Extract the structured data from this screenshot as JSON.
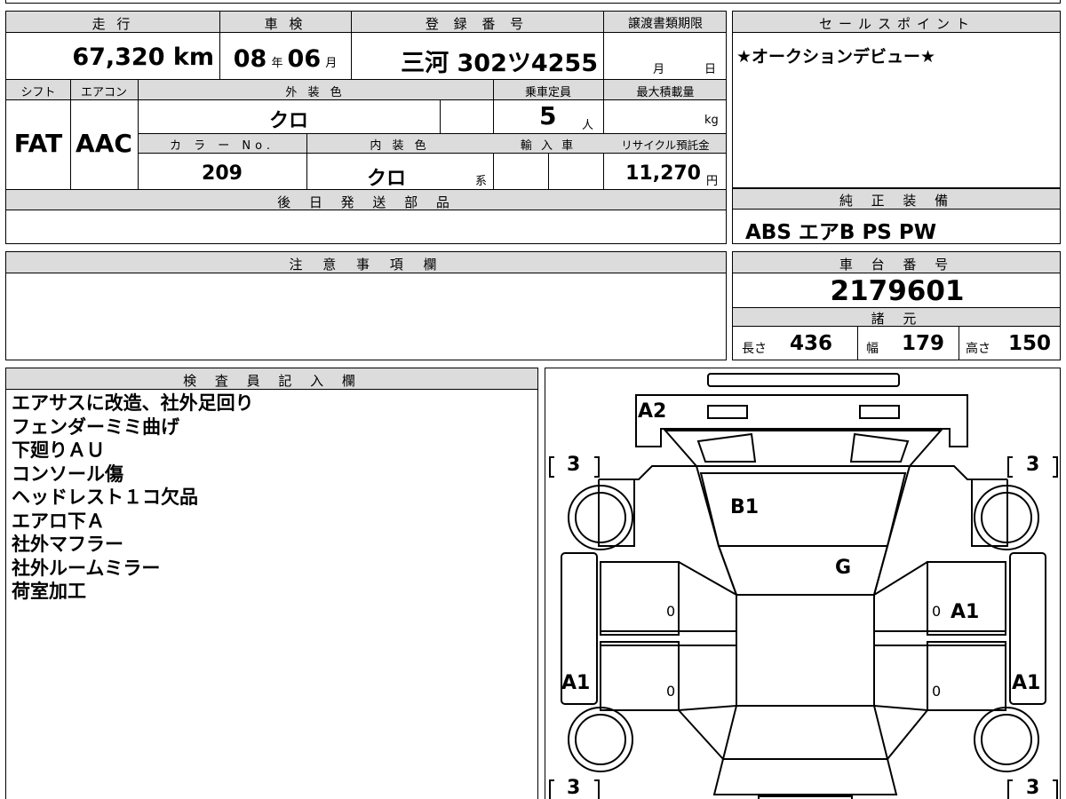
{
  "header": {
    "mileage_label": "走 行",
    "inspection_label": "車 検",
    "registration_label": "登 録 番 号",
    "transfer_deadline_label": "譲渡書類期限",
    "mileage_value": "67,320 km",
    "inspection_year": "08",
    "inspection_year_unit": "年",
    "inspection_month": "06",
    "inspection_month_unit": "月",
    "registration_value": "三河 302ツ4255",
    "deadline_month_unit": "月",
    "deadline_day_unit": "日"
  },
  "specs": {
    "shift_label": "シフト",
    "ac_label": "エアコン",
    "exterior_label": "外 装 色",
    "capacity_label": "乗車定員",
    "max_load_label": "最大積載量",
    "shift_value": "FAT",
    "ac_value": "AAC",
    "exterior_value": "クロ",
    "capacity_value": "5",
    "capacity_unit": "人",
    "max_load_unit": "kg",
    "color_no_label": "カ ラ ー No.",
    "interior_label": "内 装 色",
    "import_label": "輸 入 車",
    "recycle_label": "リサイクル預託金",
    "color_no_value": "209",
    "interior_value": "クロ",
    "interior_suffix": "系",
    "recycle_value": "11,270",
    "recycle_unit": "円"
  },
  "deferred_parts": {
    "label": "後 日 発 送 部 品",
    "value": ""
  },
  "notes": {
    "label": "注 意 事 項 欄",
    "value": ""
  },
  "sales_point": {
    "label": "セールスポイント",
    "value": "★オークションデビュー★"
  },
  "equipment": {
    "label": "純 正 装 備",
    "value": "ABS エアB PS PW"
  },
  "chassis": {
    "label": "車 台 番 号",
    "value": "2179601"
  },
  "dimensions": {
    "label": "諸 元",
    "length_label": "長さ",
    "length_value": "436",
    "width_label": "幅",
    "width_value": "179",
    "height_label": "高さ",
    "height_value": "150"
  },
  "inspector": {
    "label": "検 査 員 記 入 欄",
    "lines": [
      "エアサスに改造、社外足回り",
      "フェンダーミミ曲げ",
      "下廻りＡＵ",
      "コンソール傷",
      "ヘッドレスト１コ欠品",
      "エアロ下Ａ",
      "社外マフラー",
      "社外ルームミラー",
      "荷室加工"
    ]
  },
  "diagram": {
    "marks": {
      "front_bumper": "A2",
      "windshield": "B1",
      "roof": "G",
      "right_door": "A1",
      "left_fender": "A1",
      "right_fender": "A1"
    },
    "tire_tread": "3",
    "door_zeros": "0"
  }
}
